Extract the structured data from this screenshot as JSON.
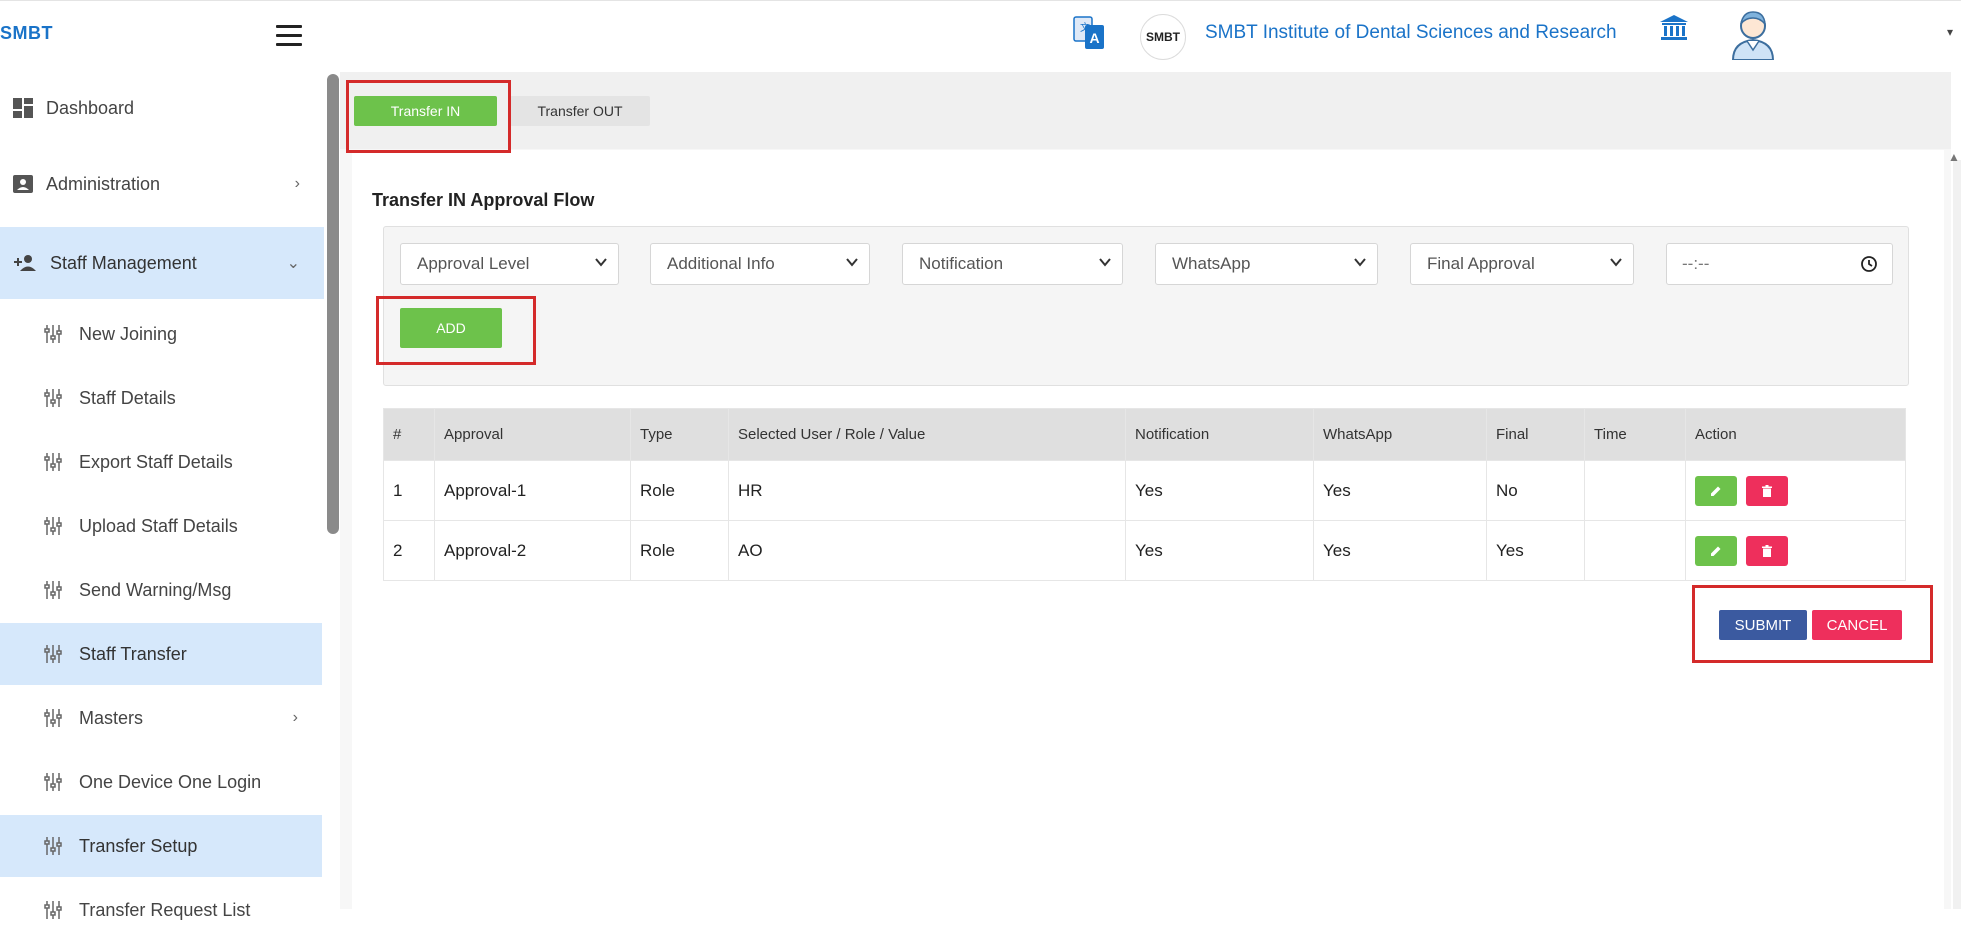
{
  "header": {
    "brand": "SMBT",
    "org_logo_text": "SMBT",
    "org_name": "SMBT Institute of Dental Sciences and Research",
    "icons": [
      "menu-icon",
      "translate-icon",
      "bank-icon",
      "user-avatar-icon",
      "caret-down-icon"
    ]
  },
  "sidebar": {
    "items": [
      {
        "label": "Dashboard",
        "icon": "dashboard-icon"
      },
      {
        "label": "Administration",
        "icon": "contact-card-icon"
      },
      {
        "label": "Staff Management",
        "icon": "group-add-icon"
      }
    ],
    "sub_items": [
      {
        "label": "New Joining"
      },
      {
        "label": "Staff Details"
      },
      {
        "label": "Export Staff Details"
      },
      {
        "label": "Upload Staff Details"
      },
      {
        "label": "Send Warning/Msg"
      },
      {
        "label": "Staff Transfer"
      },
      {
        "label": "Masters"
      },
      {
        "label": "One Device One Login"
      },
      {
        "label": "Transfer Setup"
      },
      {
        "label": "Transfer Request List"
      }
    ]
  },
  "tabs": {
    "transfer_in": "Transfer IN",
    "transfer_out": "Transfer OUT"
  },
  "section_title": "Transfer IN Approval Flow",
  "filters": {
    "approval_level": "Approval Level",
    "additional_info": "Additional Info",
    "notification": "Notification",
    "whatsapp": "WhatsApp",
    "final_approval": "Final Approval",
    "time_placeholder": "--:--",
    "add_label": "ADD"
  },
  "table": {
    "columns": [
      "#",
      "Approval",
      "Type",
      "Selected User / Role / Value",
      "Notification",
      "WhatsApp",
      "Final",
      "Time",
      "Action"
    ],
    "rows": [
      {
        "num": "1",
        "approval": "Approval-1",
        "type": "Role",
        "selected": "HR",
        "notification": "Yes",
        "whatsapp": "Yes",
        "final": "No",
        "time": ""
      },
      {
        "num": "2",
        "approval": "Approval-2",
        "type": "Role",
        "selected": "AO",
        "notification": "Yes",
        "whatsapp": "Yes",
        "final": "Yes",
        "time": ""
      }
    ]
  },
  "actions": {
    "submit": "SUBMIT",
    "cancel": "CANCEL"
  },
  "colors": {
    "accent_green": "#6dc24b",
    "danger": "#ee2f5c",
    "primary_blue": "#3b5aa0",
    "link_blue": "#1a73c8",
    "sidebar_highlight": "#d6e8fb",
    "annotation_red": "#d42a2a"
  }
}
